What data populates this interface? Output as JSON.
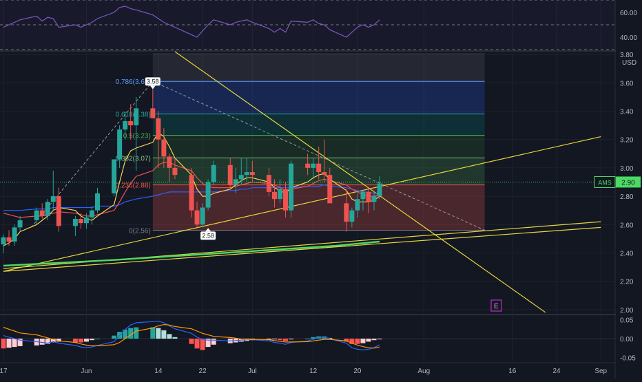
{
  "colors": {
    "background": "#131722",
    "grid": "#1e222d",
    "bull": "#26a69a",
    "bear": "#ef5350",
    "yellow_line": "#e6d63c",
    "green_ma": "#4cd964",
    "rsi_line": "#7e57c2",
    "macd_line": "#2962ff",
    "signal_line": "#ff9800",
    "price_tag": "#4cd964",
    "earnings_marker": "#9c27b0"
  },
  "top_panel": {
    "name": "RSI",
    "ticks": [
      "60.00",
      "40.00"
    ],
    "ylim": [
      30,
      70
    ],
    "levels": [
      70,
      50,
      30
    ]
  },
  "price_panel": {
    "currency": "USD",
    "ticks": [
      "3.80",
      "3.60",
      "3.40",
      "3.20",
      "3.00",
      "2.80",
      "2.60",
      "2.40",
      "2.20",
      "2.00"
    ],
    "ylim": [
      1.97,
      3.82
    ],
    "symbol": "AMS",
    "last_price": "2.90",
    "last_price_value": 2.9,
    "high_marker": "3.58",
    "low_marker": "2.58",
    "earnings_label": "E"
  },
  "fib_levels": [
    {
      "label": "0.786(3.61)",
      "value": 3.61
    },
    {
      "label": "0.618(3.38)",
      "value": 3.38
    },
    {
      "label": "0.5(3.23)",
      "value": 3.23
    },
    {
      "label": "0.382(3.07)",
      "value": 3.07
    },
    {
      "label": "0.236(2.88)",
      "value": 2.88
    },
    {
      "label": "0(2.56)",
      "value": 2.56
    }
  ],
  "x_axis": {
    "labels": [
      {
        "text": "17",
        "day": 0
      },
      {
        "text": "Jun",
        "day": 15
      },
      {
        "text": "14",
        "day": 28
      },
      {
        "text": "22",
        "day": 36
      },
      {
        "text": "Jul",
        "day": 45
      },
      {
        "text": "12",
        "day": 56
      },
      {
        "text": "20",
        "day": 64
      },
      {
        "text": "Aug",
        "day": 76
      },
      {
        "text": "16",
        "day": 92
      },
      {
        "text": "24",
        "day": 100
      },
      {
        "text": "Sep",
        "day": 108
      }
    ]
  },
  "macd_panel": {
    "ticks": [
      "0.05",
      "0.00",
      "-0.05"
    ],
    "ylim": [
      -0.06,
      0.06
    ]
  },
  "chart_data": {
    "type": "candlestick",
    "days": [
      0,
      1,
      2,
      3,
      6,
      7,
      8,
      9,
      10,
      13,
      14,
      15,
      16,
      17,
      20,
      21,
      22,
      23,
      24,
      27,
      28,
      29,
      30,
      31,
      34,
      35,
      36,
      37,
      38,
      41,
      42,
      43,
      44,
      45,
      48,
      49,
      50,
      51,
      52,
      55,
      56,
      57,
      58,
      59,
      62,
      63,
      64,
      65,
      66,
      67,
      68
    ],
    "ohlc": [
      [
        2.46,
        2.53,
        2.4,
        2.51
      ],
      [
        2.51,
        2.56,
        2.45,
        2.48
      ],
      [
        2.48,
        2.6,
        2.45,
        2.58
      ],
      [
        2.58,
        2.66,
        2.55,
        2.63
      ],
      [
        2.63,
        2.72,
        2.6,
        2.7
      ],
      [
        2.7,
        2.75,
        2.64,
        2.66
      ],
      [
        2.66,
        2.78,
        2.63,
        2.76
      ],
      [
        2.76,
        2.98,
        2.7,
        2.8
      ],
      [
        2.8,
        2.86,
        2.55,
        2.59
      ],
      [
        2.59,
        2.66,
        2.52,
        2.64
      ],
      [
        2.64,
        2.68,
        2.57,
        2.61
      ],
      [
        2.61,
        2.68,
        2.57,
        2.65
      ],
      [
        2.65,
        2.73,
        2.6,
        2.7
      ],
      [
        2.7,
        2.86,
        2.68,
        2.82
      ],
      [
        2.82,
        3.05,
        2.8,
        3.06
      ],
      [
        3.06,
        3.3,
        3.0,
        3.27
      ],
      [
        3.27,
        3.4,
        3.2,
        3.33
      ],
      [
        3.33,
        3.45,
        3.2,
        3.3
      ],
      [
        3.3,
        3.5,
        2.98,
        3.42
      ],
      [
        3.42,
        3.58,
        3.35,
        3.35
      ],
      [
        3.35,
        3.4,
        3.0,
        3.2
      ],
      [
        3.2,
        3.28,
        3.0,
        3.08
      ],
      [
        3.08,
        3.1,
        2.9,
        3.0
      ],
      [
        3.0,
        3.07,
        2.92,
        2.95
      ],
      [
        2.95,
        3.0,
        2.65,
        2.7
      ],
      [
        2.7,
        2.76,
        2.58,
        2.6
      ],
      [
        2.6,
        2.75,
        2.58,
        2.72
      ],
      [
        2.72,
        2.92,
        2.7,
        2.9
      ],
      [
        2.9,
        3.05,
        2.88,
        3.02
      ],
      [
        3.02,
        3.07,
        2.85,
        2.88
      ],
      [
        2.88,
        3.0,
        2.82,
        2.92
      ],
      [
        2.92,
        3.07,
        2.88,
        2.95
      ],
      [
        2.95,
        3.07,
        2.9,
        2.97
      ],
      [
        2.97,
        3.05,
        2.9,
        2.95
      ],
      [
        2.95,
        3.0,
        2.8,
        2.83
      ],
      [
        2.83,
        2.92,
        2.72,
        2.78
      ],
      [
        2.78,
        2.92,
        2.75,
        2.85
      ],
      [
        2.85,
        2.9,
        2.65,
        2.7
      ],
      [
        2.7,
        3.05,
        2.65,
        3.03
      ],
      [
        3.03,
        3.1,
        2.95,
        3.0
      ],
      [
        3.0,
        3.07,
        2.92,
        3.03
      ],
      [
        3.03,
        3.15,
        2.92,
        2.97
      ],
      [
        2.97,
        3.2,
        2.9,
        2.95
      ],
      [
        2.95,
        3.0,
        2.8,
        2.75
      ],
      [
        2.75,
        2.85,
        2.55,
        2.62
      ],
      [
        2.62,
        2.72,
        2.58,
        2.7
      ],
      [
        2.7,
        2.82,
        2.65,
        2.78
      ],
      [
        2.78,
        2.84,
        2.7,
        2.83
      ],
      [
        2.83,
        2.85,
        2.68,
        2.76
      ],
      [
        2.76,
        2.84,
        2.7,
        2.8
      ],
      [
        2.8,
        2.94,
        2.78,
        2.89
      ]
    ],
    "ma_fast": [
      2.45,
      2.47,
      2.5,
      2.55,
      2.6,
      2.63,
      2.66,
      2.7,
      2.72,
      2.7,
      2.66,
      2.64,
      2.63,
      2.66,
      2.74,
      2.9,
      3.05,
      3.12,
      3.14,
      3.18,
      3.25,
      3.22,
      3.15,
      3.07,
      2.95,
      2.85,
      2.8,
      2.8,
      2.82,
      2.85,
      2.88,
      2.91,
      2.93,
      2.93,
      2.9,
      2.86,
      2.84,
      2.82,
      2.86,
      2.9,
      2.93,
      2.95,
      2.96,
      2.92,
      2.84,
      2.78,
      2.76,
      2.76,
      2.76,
      2.77,
      2.8
    ],
    "ma_mid": [
      2.68,
      2.67,
      2.66,
      2.65,
      2.66,
      2.66,
      2.67,
      2.68,
      2.69,
      2.68,
      2.67,
      2.66,
      2.66,
      2.67,
      2.7,
      2.76,
      2.83,
      2.89,
      2.94,
      2.98,
      3.02,
      3.04,
      3.04,
      3.02,
      2.98,
      2.93,
      2.89,
      2.87,
      2.86,
      2.86,
      2.87,
      2.88,
      2.89,
      2.9,
      2.89,
      2.88,
      2.86,
      2.84,
      2.85,
      2.87,
      2.89,
      2.91,
      2.92,
      2.91,
      2.88,
      2.85,
      2.83,
      2.81,
      2.8,
      2.8,
      2.81
    ],
    "ma_slow": [
      2.7,
      2.7,
      2.7,
      2.7,
      2.71,
      2.71,
      2.71,
      2.72,
      2.72,
      2.72,
      2.72,
      2.72,
      2.72,
      2.73,
      2.73,
      2.74,
      2.76,
      2.77,
      2.78,
      2.8,
      2.81,
      2.82,
      2.83,
      2.83,
      2.83,
      2.83,
      2.83,
      2.83,
      2.83,
      2.84,
      2.84,
      2.85,
      2.85,
      2.86,
      2.86,
      2.86,
      2.86,
      2.86,
      2.86,
      2.87,
      2.87,
      2.87,
      2.88,
      2.87,
      2.86,
      2.85,
      2.84,
      2.83,
      2.83,
      2.82,
      2.82
    ],
    "ma_long": {
      "days": [
        0,
        20,
        40,
        60,
        68
      ],
      "values": [
        2.31,
        2.35,
        2.4,
        2.45,
        2.48
      ]
    },
    "trendlines": [
      {
        "d1": 0,
        "p1": 2.27,
        "d2": 108,
        "p2": 3.22
      },
      {
        "d1": 0,
        "p1": 2.29,
        "d2": 108,
        "p2": 2.62
      },
      {
        "d1": 0,
        "p1": 2.27,
        "d2": 108,
        "p2": 2.58
      },
      {
        "d1": 31,
        "p1": 3.82,
        "d2": 98,
        "p2": 1.98
      }
    ],
    "fib_range": {
      "d1": 27,
      "d2": 87
    },
    "fib_diagonal": {
      "d1": 27,
      "p1": 3.61,
      "d2": 87,
      "p2": 2.56
    },
    "rsi": [
      48,
      50,
      52,
      54,
      57,
      53,
      56,
      55,
      48,
      50,
      48,
      50,
      52,
      55,
      60,
      64,
      65,
      63,
      62,
      58,
      55,
      52,
      50,
      48,
      42,
      40,
      45,
      50,
      54,
      50,
      52,
      53,
      54,
      52,
      47,
      44,
      47,
      44,
      53,
      52,
      54,
      51,
      50,
      46,
      40,
      44,
      48,
      50,
      48,
      50,
      54
    ],
    "macd": [
      0.008,
      0.004,
      0.0,
      -0.004,
      -0.008,
      -0.01,
      -0.012,
      -0.008,
      -0.012,
      -0.018,
      -0.022,
      -0.024,
      -0.022,
      -0.018,
      -0.008,
      0.008,
      0.024,
      0.036,
      0.042,
      0.045,
      0.046,
      0.042,
      0.034,
      0.026,
      0.014,
      0.004,
      -0.002,
      -0.004,
      -0.004,
      -0.006,
      -0.005,
      -0.004,
      -0.003,
      -0.003,
      -0.006,
      -0.01,
      -0.012,
      -0.015,
      -0.01,
      -0.006,
      -0.002,
      0.002,
      0.004,
      0.0,
      -0.012,
      -0.024,
      -0.028,
      -0.03,
      -0.028,
      -0.024,
      -0.016
    ],
    "signal": [
      0.03,
      0.025,
      0.02,
      0.015,
      0.01,
      0.006,
      0.002,
      -0.002,
      -0.006,
      -0.01,
      -0.014,
      -0.017,
      -0.019,
      -0.019,
      -0.016,
      -0.01,
      0.0,
      0.01,
      0.02,
      0.028,
      0.034,
      0.037,
      0.036,
      0.032,
      0.026,
      0.02,
      0.014,
      0.01,
      0.006,
      0.003,
      0.001,
      -0.001,
      -0.002,
      -0.002,
      -0.003,
      -0.005,
      -0.007,
      -0.009,
      -0.009,
      -0.008,
      -0.006,
      -0.004,
      -0.002,
      -0.002,
      -0.006,
      -0.012,
      -0.017,
      -0.021,
      -0.024,
      -0.025,
      -0.022
    ],
    "histogram": [
      -0.026,
      -0.024,
      -0.022,
      -0.02,
      -0.018,
      -0.016,
      -0.014,
      -0.01,
      -0.008,
      -0.01,
      -0.01,
      -0.008,
      -0.004,
      0.0,
      0.008,
      0.018,
      0.024,
      0.028,
      0.03,
      0.03,
      0.028,
      0.022,
      0.012,
      0.004,
      -0.014,
      -0.026,
      -0.03,
      -0.022,
      -0.016,
      -0.012,
      -0.01,
      -0.008,
      -0.006,
      -0.004,
      -0.003,
      -0.002,
      -0.004,
      -0.006,
      -0.002,
      0.0,
      0.004,
      0.006,
      0.006,
      0.002,
      -0.008,
      -0.014,
      -0.014,
      -0.012,
      -0.008,
      -0.004,
      -0.002
    ]
  }
}
